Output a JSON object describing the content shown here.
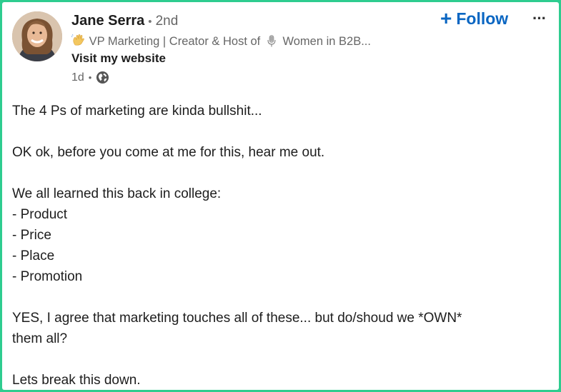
{
  "post": {
    "author": {
      "name": "Jane Serra",
      "degree": "2nd",
      "separator": "•",
      "headline_before_icon": "VP Marketing | Creator & Host of",
      "headline_after_icon": "Women in B2B...",
      "headline_icons": [
        "waving-hand-icon",
        "microphone-icon"
      ],
      "website_label": "Visit my website"
    },
    "timestamp": "1d",
    "meta_separator": "•",
    "visibility_icon": "globe-icon",
    "follow_label": "Follow",
    "follow_icon": "+",
    "more_label": "···",
    "content_lines": [
      "The 4 Ps of marketing are kinda bullshit...",
      "",
      "OK ok, before you come at me for this, hear me out.",
      "",
      "We all learned this back in college:",
      "- Product",
      "- Price",
      "- Place",
      "- Promotion",
      "",
      "YES, I agree that marketing touches all of these... but do/shoud we *OWN*",
      "them all?",
      "",
      "Lets break this down."
    ]
  },
  "colors": {
    "frame_border": "#2ecc8f",
    "follow_blue": "#0a66c2",
    "text_primary": "#1d1d1d",
    "text_secondary": "#666666"
  }
}
